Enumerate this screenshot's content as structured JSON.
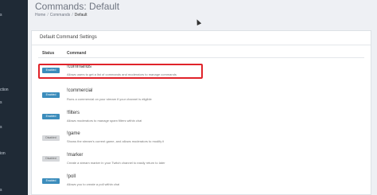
{
  "sidebar": {
    "items": [
      {
        "label": "s"
      },
      {
        "label": "ction"
      },
      {
        "label": "s"
      },
      {
        "label": "s"
      },
      {
        "label": "ion"
      },
      {
        "label": "s"
      }
    ]
  },
  "header": {
    "title": "Commands: Default",
    "breadcrumb": [
      "Home",
      "Commands",
      "Default"
    ]
  },
  "panel": {
    "title": "Default Command Settings",
    "columns": {
      "status": "Status",
      "command": "Command"
    }
  },
  "commands": [
    {
      "status": "Enabled",
      "name": "!commands",
      "description": "Allows users to get a list of commands and moderators to manage commands"
    },
    {
      "status": "Enabled",
      "name": "!commercial",
      "description": "Runs a commercial on your stream if your channel is eligible"
    },
    {
      "status": "Enabled",
      "name": "!filters",
      "description": "Allows moderators to manage spam filters within chat"
    },
    {
      "status": "Disabled",
      "name": "!game",
      "description": "Shows the stream's current game, and allows moderators to modify it"
    },
    {
      "status": "Disabled",
      "name": "!marker",
      "description": "Create a stream marker in your Twitch channel to easily return to later"
    },
    {
      "status": "Enabled",
      "name": "!poll",
      "description": "Allows you to create a poll within chat"
    }
  ],
  "colors": {
    "sidebar_bg": "#1f2a36",
    "enabled_badge": "#3c8dbc",
    "disabled_badge": "#d6d8db",
    "highlight": "#e0232a"
  }
}
